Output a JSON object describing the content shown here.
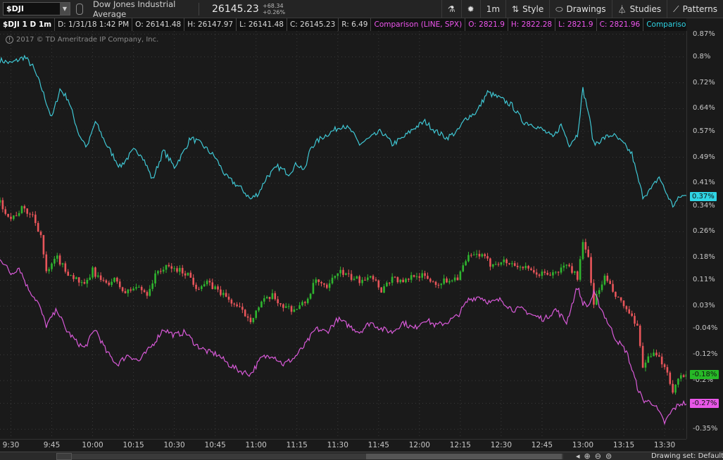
{
  "toolbar": {
    "symbol": "$DJI",
    "description": "Dow Jones Industrial Average",
    "last_price": "26145.23",
    "change_abs": "+68.34",
    "change_pct": "+0.26%",
    "timeframe_label": "1m",
    "style_label": "Style",
    "drawings_label": "Drawings",
    "studies_label": "Studies",
    "patterns_label": "Patterns"
  },
  "infobar": {
    "main_symbol": "$DJI 1 D 1m",
    "date": "D: 1/31/18 1:42 PM",
    "open": "O: 26141.48",
    "high": "H: 26147.97",
    "low": "L: 26141.48",
    "close": "C: 26145.23",
    "range": "R: 6.49",
    "comparison1": "Comparison (LINE, SPX)",
    "c1_open": "O: 2821.9",
    "c1_high": "H: 2822.28",
    "c1_low": "L: 2821.9",
    "c1_close": "C: 2821.96",
    "comparison2": "Comparison (LINE,..."
  },
  "copyright": "2017 © TD Ameritrade IP Company, Inc.",
  "bottom": {
    "drawing_set": "Drawing set: Default"
  },
  "colors": {
    "up": "#2fb52f",
    "down": "#e8555a",
    "spx": "#d95ad9",
    "cyan": "#3fc7d4",
    "background": "#1a1a1a"
  },
  "chart_data": {
    "type": "line",
    "yaxis_unit": "%",
    "ylim": [
      -0.38,
      0.88
    ],
    "y_ticks": [
      0.87,
      0.8,
      0.72,
      0.64,
      0.57,
      0.49,
      0.41,
      0.34,
      0.26,
      0.18,
      0.11,
      0.03,
      -0.04,
      -0.12,
      -0.2,
      -0.27,
      -0.35
    ],
    "y_tick_labels": [
      "0.87%",
      "0.8%",
      "0.72%",
      "0.64%",
      "0.57%",
      "0.49%",
      "0.41%",
      "0.34%",
      "0.26%",
      "0.18%",
      "0.11%",
      "0.03%",
      "-0.04%",
      "-0.12%",
      "-0.2%",
      "-0.27%",
      "-0.35%"
    ],
    "x_ticks": [
      "9:30",
      "9:45",
      "10:00",
      "10:15",
      "10:30",
      "10:45",
      "11:00",
      "11:15",
      "11:30",
      "11:45",
      "12:00",
      "12:15",
      "12:30",
      "12:45",
      "13:00",
      "13:15",
      "13:30"
    ],
    "x_tick_minutes": [
      0,
      15,
      30,
      45,
      60,
      75,
      90,
      105,
      120,
      135,
      150,
      165,
      180,
      195,
      210,
      225,
      240
    ],
    "xlim_minutes": [
      -4,
      248
    ],
    "last_values": [
      {
        "label": "0.37%",
        "value": 0.37,
        "color": "#2fd4e4"
      },
      {
        "label": "-0.18%",
        "value": -0.18,
        "color": "#27b927"
      },
      {
        "label": "-0.27%",
        "value": -0.27,
        "color": "#e857e8"
      }
    ],
    "series": [
      {
        "style": "line",
        "color": "#3fc7d4",
        "keypoints": [
          [
            -4,
            0.79
          ],
          [
            0,
            0.78
          ],
          [
            5,
            0.8
          ],
          [
            8,
            0.77
          ],
          [
            11,
            0.71
          ],
          [
            15,
            0.61
          ],
          [
            18,
            0.7
          ],
          [
            21,
            0.67
          ],
          [
            25,
            0.56
          ],
          [
            28,
            0.52
          ],
          [
            31,
            0.6
          ],
          [
            35,
            0.53
          ],
          [
            40,
            0.46
          ],
          [
            45,
            0.51
          ],
          [
            48,
            0.5
          ],
          [
            52,
            0.42
          ],
          [
            56,
            0.51
          ],
          [
            60,
            0.46
          ],
          [
            63,
            0.5
          ],
          [
            66,
            0.55
          ],
          [
            70,
            0.53
          ],
          [
            75,
            0.49
          ],
          [
            79,
            0.43
          ],
          [
            82,
            0.41
          ],
          [
            85,
            0.39
          ],
          [
            88,
            0.36
          ],
          [
            91,
            0.38
          ],
          [
            94,
            0.43
          ],
          [
            98,
            0.46
          ],
          [
            102,
            0.44
          ],
          [
            105,
            0.47
          ],
          [
            108,
            0.45
          ],
          [
            110,
            0.52
          ],
          [
            114,
            0.55
          ],
          [
            118,
            0.57
          ],
          [
            122,
            0.59
          ],
          [
            125,
            0.57
          ],
          [
            128,
            0.53
          ],
          [
            132,
            0.55
          ],
          [
            136,
            0.57
          ],
          [
            140,
            0.53
          ],
          [
            144,
            0.55
          ],
          [
            148,
            0.58
          ],
          [
            152,
            0.6
          ],
          [
            156,
            0.57
          ],
          [
            160,
            0.55
          ],
          [
            164,
            0.57
          ],
          [
            167,
            0.61
          ],
          [
            171,
            0.63
          ],
          [
            175,
            0.69
          ],
          [
            180,
            0.67
          ],
          [
            184,
            0.65
          ],
          [
            188,
            0.6
          ],
          [
            192,
            0.59
          ],
          [
            196,
            0.57
          ],
          [
            199,
            0.55
          ],
          [
            202,
            0.59
          ],
          [
            205,
            0.53
          ],
          [
            208,
            0.56
          ],
          [
            210,
            0.7
          ],
          [
            212,
            0.63
          ],
          [
            214,
            0.53
          ],
          [
            218,
            0.55
          ],
          [
            221,
            0.56
          ],
          [
            225,
            0.53
          ],
          [
            228,
            0.5
          ],
          [
            230,
            0.43
          ],
          [
            232,
            0.37
          ],
          [
            235,
            0.39
          ],
          [
            238,
            0.43
          ],
          [
            240,
            0.39
          ],
          [
            243,
            0.34
          ],
          [
            246,
            0.37
          ],
          [
            248,
            0.37
          ]
        ]
      },
      {
        "style": "candles",
        "keypoints": [
          [
            -4,
            0.35
          ],
          [
            0,
            0.3
          ],
          [
            4,
            0.33
          ],
          [
            8,
            0.31
          ],
          [
            11,
            0.25
          ],
          [
            13,
            0.13
          ],
          [
            17,
            0.18
          ],
          [
            20,
            0.14
          ],
          [
            23,
            0.12
          ],
          [
            27,
            0.09
          ],
          [
            30,
            0.14
          ],
          [
            34,
            0.1
          ],
          [
            38,
            0.11
          ],
          [
            42,
            0.07
          ],
          [
            46,
            0.09
          ],
          [
            50,
            0.07
          ],
          [
            54,
            0.14
          ],
          [
            58,
            0.15
          ],
          [
            62,
            0.14
          ],
          [
            65,
            0.13
          ],
          [
            68,
            0.09
          ],
          [
            72,
            0.1
          ],
          [
            76,
            0.08
          ],
          [
            80,
            0.05
          ],
          [
            84,
            0.02
          ],
          [
            88,
            -0.01
          ],
          [
            92,
            0.04
          ],
          [
            96,
            0.06
          ],
          [
            100,
            0.03
          ],
          [
            104,
            0.02
          ],
          [
            108,
            0.04
          ],
          [
            112,
            0.11
          ],
          [
            116,
            0.08
          ],
          [
            120,
            0.14
          ],
          [
            124,
            0.12
          ],
          [
            128,
            0.11
          ],
          [
            132,
            0.13
          ],
          [
            136,
            0.08
          ],
          [
            140,
            0.12
          ],
          [
            144,
            0.1
          ],
          [
            148,
            0.13
          ],
          [
            152,
            0.12
          ],
          [
            156,
            0.1
          ],
          [
            160,
            0.11
          ],
          [
            164,
            0.12
          ],
          [
            168,
            0.18
          ],
          [
            172,
            0.19
          ],
          [
            176,
            0.16
          ],
          [
            180,
            0.17
          ],
          [
            184,
            0.16
          ],
          [
            188,
            0.15
          ],
          [
            192,
            0.13
          ],
          [
            196,
            0.13
          ],
          [
            200,
            0.13
          ],
          [
            204,
            0.16
          ],
          [
            208,
            0.12
          ],
          [
            210,
            0.22
          ],
          [
            212,
            0.18
          ],
          [
            214,
            0.04
          ],
          [
            218,
            0.12
          ],
          [
            222,
            0.06
          ],
          [
            226,
            0.02
          ],
          [
            230,
            -0.04
          ],
          [
            232,
            -0.15
          ],
          [
            236,
            -0.12
          ],
          [
            240,
            -0.15
          ],
          [
            243,
            -0.23
          ],
          [
            246,
            -0.18
          ],
          [
            248,
            -0.18
          ]
        ]
      },
      {
        "name": "SPX",
        "style": "line",
        "color": "#d95ad9",
        "keypoints": [
          [
            -4,
            0.18
          ],
          [
            0,
            0.13
          ],
          [
            3,
            0.15
          ],
          [
            6,
            0.09
          ],
          [
            10,
            0.04
          ],
          [
            13,
            -0.03
          ],
          [
            17,
            0.02
          ],
          [
            20,
            -0.04
          ],
          [
            24,
            -0.08
          ],
          [
            27,
            -0.1
          ],
          [
            31,
            -0.04
          ],
          [
            35,
            -0.11
          ],
          [
            39,
            -0.15
          ],
          [
            43,
            -0.12
          ],
          [
            47,
            -0.14
          ],
          [
            52,
            -0.09
          ],
          [
            56,
            -0.04
          ],
          [
            60,
            -0.06
          ],
          [
            64,
            -0.05
          ],
          [
            68,
            -0.09
          ],
          [
            72,
            -0.11
          ],
          [
            76,
            -0.12
          ],
          [
            80,
            -0.15
          ],
          [
            84,
            -0.17
          ],
          [
            88,
            -0.18
          ],
          [
            92,
            -0.13
          ],
          [
            96,
            -0.12
          ],
          [
            100,
            -0.15
          ],
          [
            104,
            -0.13
          ],
          [
            108,
            -0.09
          ],
          [
            112,
            -0.04
          ],
          [
            116,
            -0.05
          ],
          [
            120,
            -0.01
          ],
          [
            124,
            -0.03
          ],
          [
            128,
            -0.05
          ],
          [
            132,
            -0.02
          ],
          [
            136,
            -0.04
          ],
          [
            140,
            -0.05
          ],
          [
            144,
            -0.02
          ],
          [
            148,
            -0.04
          ],
          [
            152,
            -0.01
          ],
          [
            156,
            -0.03
          ],
          [
            160,
            -0.02
          ],
          [
            164,
            0.0
          ],
          [
            168,
            0.05
          ],
          [
            172,
            0.06
          ],
          [
            176,
            0.04
          ],
          [
            180,
            0.05
          ],
          [
            184,
            0.02
          ],
          [
            188,
            0.02
          ],
          [
            192,
            0.0
          ],
          [
            196,
            -0.01
          ],
          [
            200,
            0.02
          ],
          [
            204,
            -0.02
          ],
          [
            208,
            0.09
          ],
          [
            210,
            0.04
          ],
          [
            212,
            0.03
          ],
          [
            214,
            0.07
          ],
          [
            218,
            0.0
          ],
          [
            222,
            -0.07
          ],
          [
            226,
            -0.11
          ],
          [
            230,
            -0.22
          ],
          [
            232,
            -0.26
          ],
          [
            236,
            -0.27
          ],
          [
            240,
            -0.33
          ],
          [
            243,
            -0.29
          ],
          [
            246,
            -0.27
          ],
          [
            248,
            -0.27
          ]
        ]
      }
    ]
  }
}
